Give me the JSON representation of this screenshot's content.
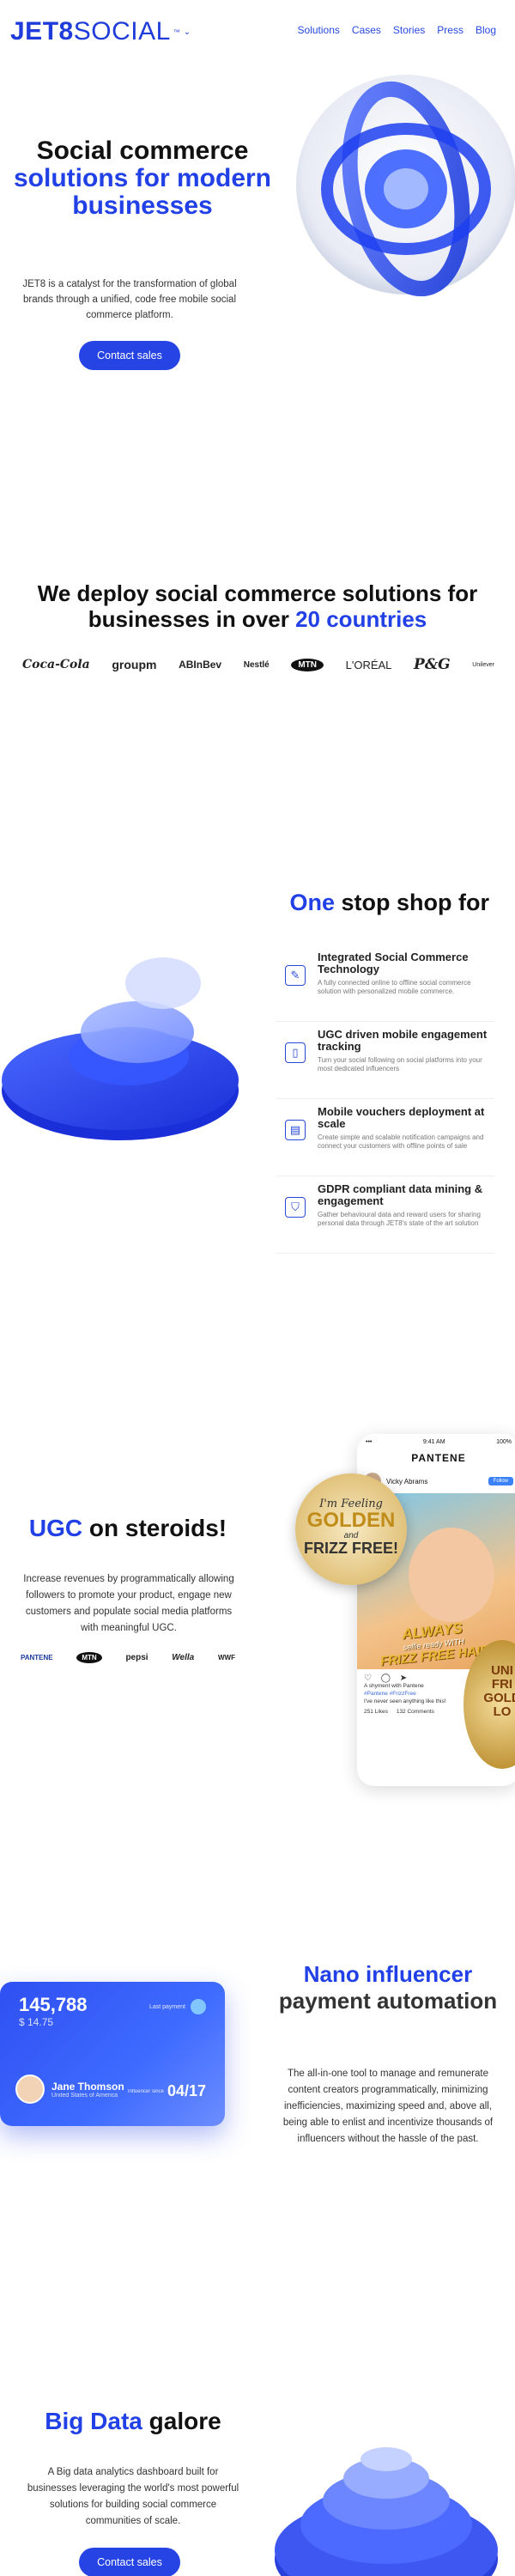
{
  "header": {
    "logo_bold": "JET8",
    "logo_light": "SOCIAL",
    "logo_tm": "™",
    "nav": [
      "Solutions",
      "Cases",
      "Stories",
      "Press",
      "Blog"
    ]
  },
  "hero": {
    "title_line1": "Social commerce",
    "title_blue": "solutions for modern businesses",
    "description": "JET8 is a catalyst for the transformation of global brands through a unified, code free mobile social commerce platform.",
    "cta": "Contact sales"
  },
  "deploy": {
    "title_start": "We deploy social commerce solutions for businesses in over ",
    "title_blue": "20 countries",
    "logos": [
      "Coca-Cola",
      "groupm",
      "ABInBev",
      "Nestlé",
      "MTN",
      "L'ORÉAL",
      "P&G",
      "Unilever"
    ]
  },
  "one_stop": {
    "title_blue": "One",
    "title_rest": " stop shop for",
    "features": [
      {
        "icon": "pen-icon",
        "glyph": "✎",
        "title": "Integrated Social Commerce Technology",
        "desc": "A fully connected online to offline social commerce solution with personalized mobile commerce."
      },
      {
        "icon": "phone-icon",
        "glyph": "▯",
        "title": "UGC driven mobile engagement tracking",
        "desc": "Turn your social following on social platforms into your most dedicated influencers"
      },
      {
        "icon": "voucher-icon",
        "glyph": "▤",
        "title": "Mobile vouchers deployment at scale",
        "desc": "Create simple and scalable notification campaigns and connect your customers with offline points of sale"
      },
      {
        "icon": "shield-icon",
        "glyph": "⛉",
        "title": "GDPR compliant data mining & engagement",
        "desc": "Gather behavioural data and reward users for sharing personal data through JET8's state of the art solution"
      }
    ]
  },
  "ugc": {
    "title_blue": "UGC",
    "title_rest": " on steroids!",
    "description": "Increase revenues by programmatically allowing followers to promote your product, engage new customers and populate social media platforms with meaningful UGC.",
    "logos": [
      "PANTENE",
      "MTN",
      "pepsi",
      "Wella",
      "WWF"
    ],
    "phone": {
      "time": "9:41 AM",
      "battery": "100%",
      "brand": "PANTENE",
      "user": "Vicky Abrams",
      "follow": "Follow",
      "liked": "A shyment with Pantene",
      "hashtags": "#Pantene #FrizzFree",
      "caption": "I've never seen anything like this!",
      "likes": "251 Likes",
      "comments": "132 Comments"
    },
    "promo": {
      "line1": "I'm Feeling",
      "line2": "GOLDEN",
      "line3": "and",
      "line4": "FRIZZ FREE!"
    },
    "banner": {
      "line1": "ALWAYS",
      "line2": "selfie ready WITH",
      "line3": "FRIZZ FREE HAIR"
    },
    "side_promo": {
      "line1": "UNI",
      "line2": "FRI",
      "line3": "GOLD",
      "line4": "LO"
    }
  },
  "nano": {
    "title_blue": "Nano influencer",
    "title_rest": "payment automation",
    "description": "The all-in-one tool to manage and remunerate content creators programmatically, minimizing inefficiencies, maximizing speed and, above all, being able to enlist and incentivize thousands of influencers without the hassle of the past.",
    "card": {
      "amount": "145,788",
      "sub_amount": "$ 14.75",
      "last_label": "Last payment",
      "holder_name": "Jane Thomson",
      "holder_sub": "United States of America",
      "since_label": "Influencer since",
      "since_value": "04/17"
    }
  },
  "big_data": {
    "title_blue": "Big Data",
    "title_rest": " galore",
    "description": "A Big data analytics dashboard built for businesses leveraging the world's most powerful solutions for building social commerce communities of scale.",
    "cta": "Contact sales"
  }
}
